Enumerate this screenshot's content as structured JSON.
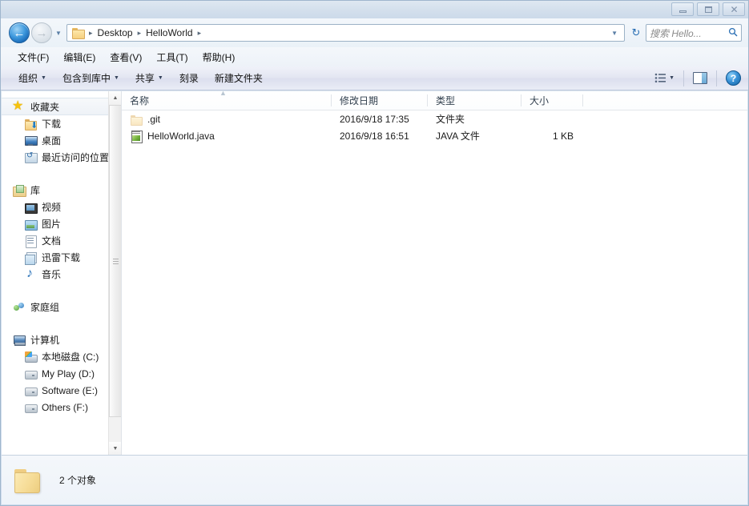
{
  "window": {
    "controls": [
      {
        "name": "minimize",
        "glyph": "–"
      },
      {
        "name": "maximize",
        "glyph": "□"
      },
      {
        "name": "close",
        "glyph": "✕"
      }
    ]
  },
  "address": {
    "back_glyph": "←",
    "forward_glyph": "→",
    "history_caret": "▼",
    "breadcrumb": [
      "Desktop",
      "HelloWorld"
    ],
    "separator": "▸",
    "dropdown_caret": "▼",
    "refresh_glyph": "↻"
  },
  "search": {
    "placeholder": "搜索 Hello...",
    "icon": "🔍"
  },
  "menubar": {
    "items": [
      {
        "label": "文件(F)"
      },
      {
        "label": "编辑(E)"
      },
      {
        "label": "查看(V)"
      },
      {
        "label": "工具(T)"
      },
      {
        "label": "帮助(H)"
      }
    ]
  },
  "toolbar": {
    "items": [
      {
        "label": "组织",
        "caret": "▼"
      },
      {
        "label": "包含到库中",
        "caret": "▼"
      },
      {
        "label": "共享",
        "caret": "▼"
      },
      {
        "label": "刻录",
        "caret": ""
      },
      {
        "label": "新建文件夹",
        "caret": ""
      }
    ],
    "view_caret": "▼",
    "help_glyph": "?"
  },
  "sidebar": {
    "groups": [
      {
        "header": {
          "label": "收藏夹",
          "icon": "star-icon",
          "selected": true
        },
        "items": [
          {
            "label": "下载",
            "icon": "download-folder-icon"
          },
          {
            "label": "桌面",
            "icon": "desktop-icon"
          },
          {
            "label": "最近访问的位置",
            "icon": "recent-places-icon"
          }
        ]
      },
      {
        "header": {
          "label": "库",
          "icon": "library-icon",
          "selected": false
        },
        "items": [
          {
            "label": "视频",
            "icon": "video-icon"
          },
          {
            "label": "图片",
            "icon": "picture-icon"
          },
          {
            "label": "文档",
            "icon": "document-icon"
          },
          {
            "label": "迅雷下载",
            "icon": "xunlei-icon"
          },
          {
            "label": "音乐",
            "icon": "music-icon"
          }
        ]
      },
      {
        "header": {
          "label": "家庭组",
          "icon": "homegroup-icon",
          "selected": false
        },
        "items": []
      },
      {
        "header": {
          "label": "计算机",
          "icon": "computer-icon",
          "selected": false
        },
        "items": [
          {
            "label": "本地磁盘 (C:)",
            "icon": "local-disk-icon"
          },
          {
            "label": "My Play (D:)",
            "icon": "drive-icon"
          },
          {
            "label": "Software (E:)",
            "icon": "drive-icon"
          },
          {
            "label": "Others (F:)",
            "icon": "drive-icon"
          }
        ]
      }
    ],
    "scroll_up_glyph": "▲",
    "scroll_down_glyph": "▼"
  },
  "filelist": {
    "columns": [
      {
        "key": "name",
        "label": "名称"
      },
      {
        "key": "date",
        "label": "修改日期"
      },
      {
        "key": "type",
        "label": "类型"
      },
      {
        "key": "size",
        "label": "大小"
      }
    ],
    "sort_indicator": "▲",
    "rows": [
      {
        "name": ".git",
        "date": "2016/9/18 17:35",
        "type": "文件夹",
        "size": "",
        "icon": "folder-icon"
      },
      {
        "name": "HelloWorld.java",
        "date": "2016/9/18 16:51",
        "type": "JAVA 文件",
        "size": "1 KB",
        "icon": "java-file-icon"
      }
    ]
  },
  "statusbar": {
    "text": "2 个对象",
    "icon": "folder-icon"
  }
}
